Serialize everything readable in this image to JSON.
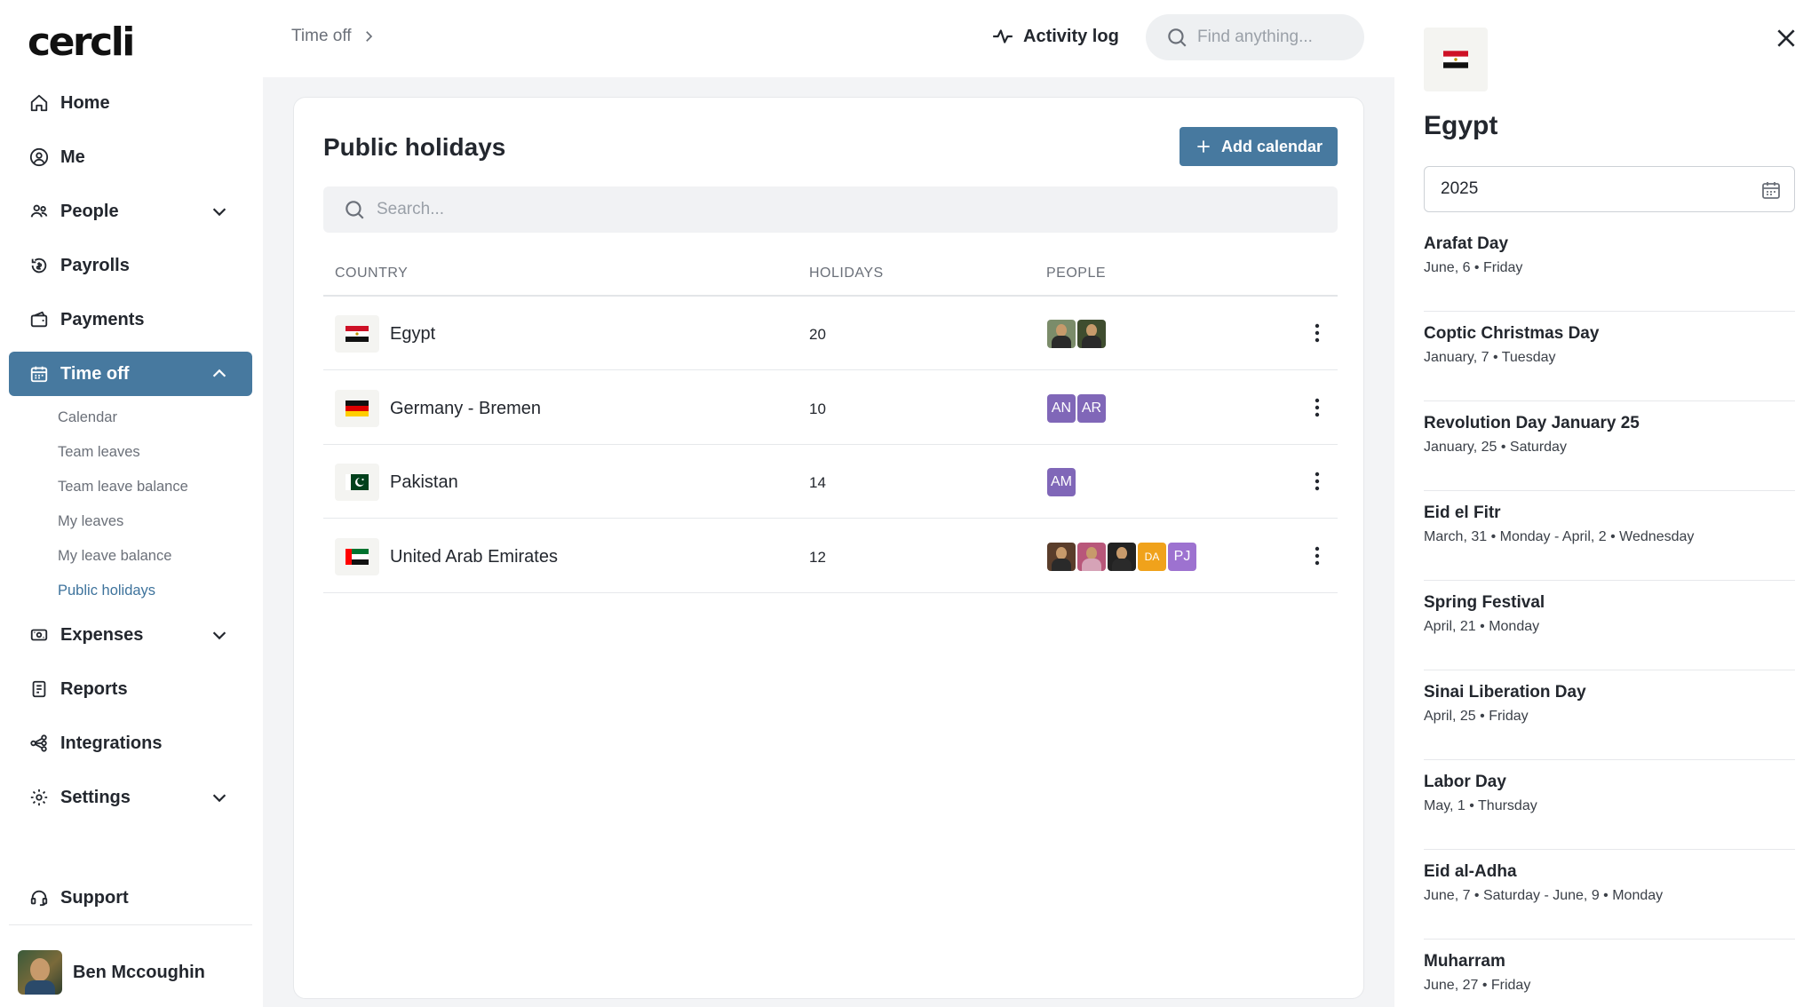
{
  "app": {
    "logo": "cercli"
  },
  "sidebar": {
    "items": [
      {
        "label": "Home",
        "icon": "home-icon"
      },
      {
        "label": "Me",
        "icon": "user-circle-icon"
      },
      {
        "label": "People",
        "icon": "people-icon",
        "expandable": true
      },
      {
        "label": "Payrolls",
        "icon": "payroll-icon"
      },
      {
        "label": "Payments",
        "icon": "wallet-icon"
      },
      {
        "label": "Time off",
        "icon": "calendar-icon",
        "expandable": true,
        "active": true
      },
      {
        "label": "Expenses",
        "icon": "receipt-icon",
        "expandable": true
      },
      {
        "label": "Reports",
        "icon": "report-icon"
      },
      {
        "label": "Integrations",
        "icon": "integrations-icon"
      },
      {
        "label": "Settings",
        "icon": "gear-icon",
        "expandable": true
      }
    ],
    "time_off_sub": [
      "Calendar",
      "Team leaves",
      "Team leave balance",
      "My leaves",
      "My leave balance",
      "Public holidays"
    ],
    "active_sub": "Public holidays",
    "support": "Support",
    "user": {
      "name": "Ben Mccoughin"
    }
  },
  "topbar": {
    "breadcrumb": "Time off",
    "activity_log": "Activity log",
    "search_placeholder": "Find anything..."
  },
  "main": {
    "title": "Public holidays",
    "add_button": "Add calendar",
    "search_placeholder": "Search...",
    "columns": [
      "COUNTRY",
      "HOLIDAYS",
      "PEOPLE"
    ],
    "rows": [
      {
        "country": "Egypt",
        "holidays": "20",
        "flag": "egypt-flag-icon",
        "people": []
      },
      {
        "country": "Germany - Bremen",
        "holidays": "10",
        "flag": "germany-flag-icon",
        "people": [
          "AN",
          "AR"
        ]
      },
      {
        "country": "Pakistan",
        "holidays": "14",
        "flag": "pakistan-flag-icon",
        "people": [
          "AM"
        ]
      },
      {
        "country": "United Arab Emirates",
        "holidays": "12",
        "flag": "uae-flag-icon",
        "people": [
          "DA",
          "PJ"
        ]
      }
    ]
  },
  "panel": {
    "title": "Egypt",
    "year": "2025",
    "holidays": [
      {
        "name": "Arafat Day",
        "date": "June, 6 • Friday"
      },
      {
        "name": "Coptic Christmas Day",
        "date": "January, 7 • Tuesday"
      },
      {
        "name": "Revolution Day January 25",
        "date": "January, 25 • Saturday"
      },
      {
        "name": "Eid el Fitr",
        "date": "March, 31 • Monday - April, 2 • Wednesday"
      },
      {
        "name": "Spring Festival",
        "date": "April, 21 • Monday"
      },
      {
        "name": "Sinai Liberation Day",
        "date": "April, 25 • Friday"
      },
      {
        "name": "Labor Day",
        "date": "May, 1 • Thursday"
      },
      {
        "name": "Eid al-Adha",
        "date": "June, 7 • Saturday - June, 9 • Monday"
      },
      {
        "name": "Muharram",
        "date": "June, 27 • Friday"
      }
    ]
  },
  "colors": {
    "accent": "#47799f",
    "active_sub": "#3e739c",
    "avatar_purple": "#8067b8",
    "avatar_orange": "#f0a21b"
  }
}
